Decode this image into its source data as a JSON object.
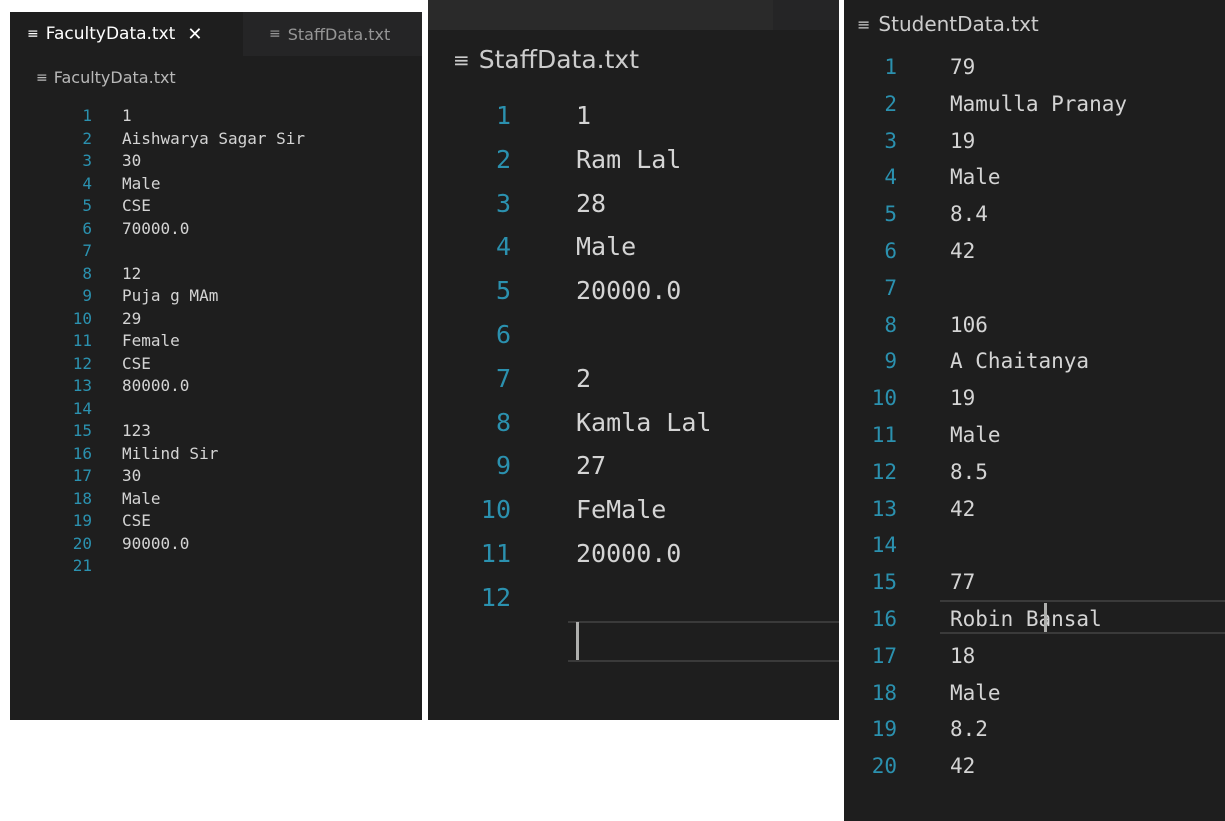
{
  "faculty": {
    "tab_active": "FacultyData.txt",
    "tab_close": "✕",
    "tab_inactive": "StaffData.txt",
    "breadcrumb": "FacultyData.txt",
    "lines": [
      {
        "n": "1",
        "t": "1"
      },
      {
        "n": "2",
        "t": "Aishwarya Sagar Sir"
      },
      {
        "n": "3",
        "t": "30"
      },
      {
        "n": "4",
        "t": "Male"
      },
      {
        "n": "5",
        "t": "CSE"
      },
      {
        "n": "6",
        "t": "70000.0"
      },
      {
        "n": "7",
        "t": ""
      },
      {
        "n": "8",
        "t": "12"
      },
      {
        "n": "9",
        "t": "Puja g MAm"
      },
      {
        "n": "10",
        "t": "29"
      },
      {
        "n": "11",
        "t": "Female"
      },
      {
        "n": "12",
        "t": "CSE"
      },
      {
        "n": "13",
        "t": "80000.0"
      },
      {
        "n": "14",
        "t": ""
      },
      {
        "n": "15",
        "t": "123"
      },
      {
        "n": "16",
        "t": "Milind Sir"
      },
      {
        "n": "17",
        "t": "30"
      },
      {
        "n": "18",
        "t": "Male"
      },
      {
        "n": "19",
        "t": "CSE"
      },
      {
        "n": "20",
        "t": "90000.0"
      },
      {
        "n": "21",
        "t": ""
      }
    ]
  },
  "staff": {
    "breadcrumb": "StaffData.txt",
    "lines": [
      {
        "n": "1",
        "t": "1"
      },
      {
        "n": "2",
        "t": "Ram Lal"
      },
      {
        "n": "3",
        "t": "28"
      },
      {
        "n": "4",
        "t": "Male"
      },
      {
        "n": "5",
        "t": "20000.0"
      },
      {
        "n": "6",
        "t": ""
      },
      {
        "n": "7",
        "t": "2"
      },
      {
        "n": "8",
        "t": "Kamla Lal"
      },
      {
        "n": "9",
        "t": "27"
      },
      {
        "n": "10",
        "t": "FeMale"
      },
      {
        "n": "11",
        "t": "20000.0"
      },
      {
        "n": "12",
        "t": ""
      }
    ]
  },
  "student": {
    "breadcrumb": "StudentData.txt",
    "lines": [
      {
        "n": "1",
        "t": "79"
      },
      {
        "n": "2",
        "t": "Mamulla Pranay"
      },
      {
        "n": "3",
        "t": "19"
      },
      {
        "n": "4",
        "t": "Male"
      },
      {
        "n": "5",
        "t": "8.4"
      },
      {
        "n": "6",
        "t": "42"
      },
      {
        "n": "7",
        "t": ""
      },
      {
        "n": "8",
        "t": "106"
      },
      {
        "n": "9",
        "t": "A Chaitanya"
      },
      {
        "n": "10",
        "t": "19"
      },
      {
        "n": "11",
        "t": "Male"
      },
      {
        "n": "12",
        "t": "8.5"
      },
      {
        "n": "13",
        "t": "42"
      },
      {
        "n": "14",
        "t": ""
      },
      {
        "n": "15",
        "t": "77"
      },
      {
        "n": "16",
        "t": "Robin Bansal"
      },
      {
        "n": "17",
        "t": "18"
      },
      {
        "n": "18",
        "t": "Male"
      },
      {
        "n": "19",
        "t": "8.2"
      },
      {
        "n": "20",
        "t": "42"
      }
    ]
  },
  "icons": {
    "file_icon": "lines-file-icon",
    "file_glyph": "≡",
    "colors": {
      "editor_bg": "#1e1e1e",
      "line_number": "#2b91af",
      "text": "#d4d4d4",
      "tabbar_bg": "#252526"
    }
  }
}
